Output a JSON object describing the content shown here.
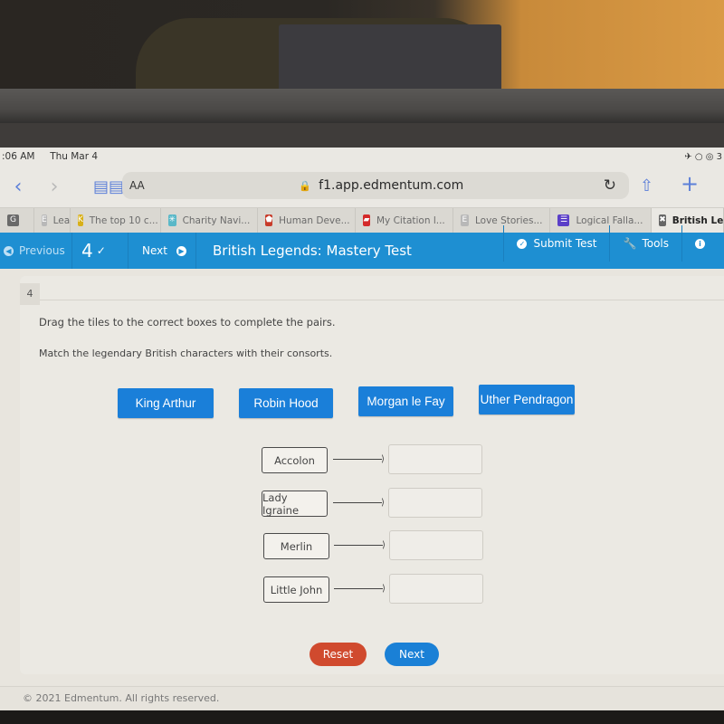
{
  "status_bar": {
    "time": ":06 AM",
    "date": "Thu Mar 4",
    "right": "✈ ○ ◎ 3"
  },
  "browser": {
    "back_icon": "‹",
    "forward_icon": "›",
    "reader_icon": "🕮",
    "text_size_label": "AA",
    "lock_icon": "🔒",
    "url": "f1.app.edmentum.com",
    "reload_icon": "↻",
    "share_icon": "⇧",
    "new_tab_icon": "+"
  },
  "tabs": [
    {
      "label": "",
      "icon": "G",
      "icon_color": "#6a6a6a"
    },
    {
      "label": "Lea",
      "icon": "E",
      "icon_color": "#b8b8b8"
    },
    {
      "label": "The top 10 c...",
      "icon": "K",
      "icon_color": "#d8b01a"
    },
    {
      "label": "Charity Navi...",
      "icon": "✳",
      "icon_color": "#5ab8c8"
    },
    {
      "label": "Human Deve...",
      "icon": "⬟",
      "icon_color": "#c83b2a"
    },
    {
      "label": "My Citation l...",
      "icon": "▰",
      "icon_color": "#d42a2a"
    },
    {
      "label": "Love Stories...",
      "icon": "E",
      "icon_color": "#b8b8b8"
    },
    {
      "label": "Logical Falla...",
      "icon": "☰",
      "icon_color": "#5b3fc8"
    },
    {
      "label": "British Le",
      "icon": "✖",
      "icon_color": "#666666"
    }
  ],
  "app_bar": {
    "previous_label": "Previous",
    "question_number": "4",
    "dropdown_icon": "⌄",
    "next_label": "Next",
    "title": "British Legends: Mastery Test",
    "submit_label": "Submit Test",
    "tools_label": "Tools",
    "info_icon": "i",
    "accent_color": "#1e8fd2"
  },
  "question": {
    "number": "4",
    "instruction": "Drag the tiles to the correct boxes to complete the pairs.",
    "prompt": "Match the legendary British characters with their consorts.",
    "tiles": [
      "King Arthur",
      "Robin Hood",
      "Morgan le Fay",
      "Uther Pendragon"
    ],
    "pairs": [
      {
        "label": "Accolon",
        "answer": ""
      },
      {
        "label": "Lady Igraine",
        "answer": ""
      },
      {
        "label": "Merlin",
        "answer": ""
      },
      {
        "label": "Little John",
        "answer": ""
      }
    ],
    "reset_label": "Reset",
    "next_label": "Next"
  },
  "footer": {
    "copyright": "© 2021 Edmentum. All rights reserved."
  }
}
